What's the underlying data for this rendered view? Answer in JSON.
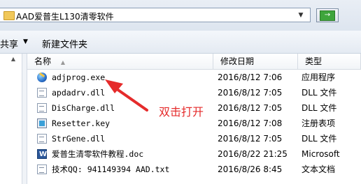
{
  "address_bar": {
    "path": "AAD爱普生L130清零软件",
    "go_label": "→"
  },
  "toolbar": {
    "share_label": "共享",
    "new_folder_label": "新建文件夹"
  },
  "columns": {
    "name": "名称",
    "date": "修改日期",
    "type": "类型"
  },
  "files": [
    {
      "name": "adjprog.exe",
      "date": "2016/8/12 7:06",
      "type": "应用程序",
      "icon": "exe-icon"
    },
    {
      "name": "apdadrv.dll",
      "date": "2016/8/12 7:05",
      "type": "DLL 文件",
      "icon": "dll-icon"
    },
    {
      "name": "DisCharge.dll",
      "date": "2016/8/12 7:05",
      "type": "DLL 文件",
      "icon": "dll-icon"
    },
    {
      "name": "Resetter.key",
      "date": "2016/8/12 7:08",
      "type": "注册表项",
      "icon": "reg-icon"
    },
    {
      "name": "StrGene.dll",
      "date": "2016/8/12 7:05",
      "type": "DLL 文件",
      "icon": "dll-icon"
    },
    {
      "name": "爱普生清零软件教程.doc",
      "date": "2016/8/22 21:25",
      "type": "Microsoft",
      "icon": "word-icon"
    },
    {
      "name": "技术QQ: 941149394 AAD.txt",
      "date": "2016/8/26 8:45",
      "type": "文本文档",
      "icon": "txt-icon"
    }
  ],
  "annotation": {
    "text": "双击打开",
    "color": "#e52b2b"
  }
}
